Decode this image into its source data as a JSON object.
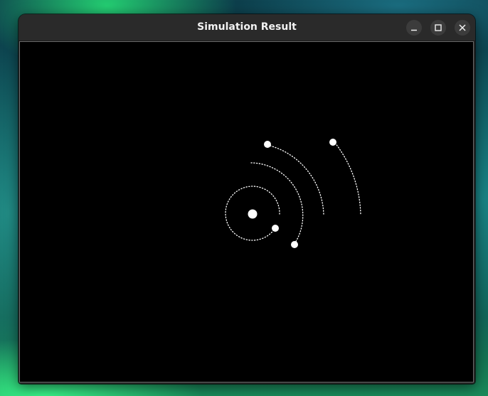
{
  "window": {
    "title": "Simulation Result",
    "controls": {
      "minimize_icon": "minimize-icon",
      "maximize_icon": "maximize-icon",
      "close_icon": "close-icon"
    }
  },
  "colors": {
    "canvas_background": "#000000",
    "trail_color": "#ffffff",
    "body_color": "#ffffff"
  }
}
